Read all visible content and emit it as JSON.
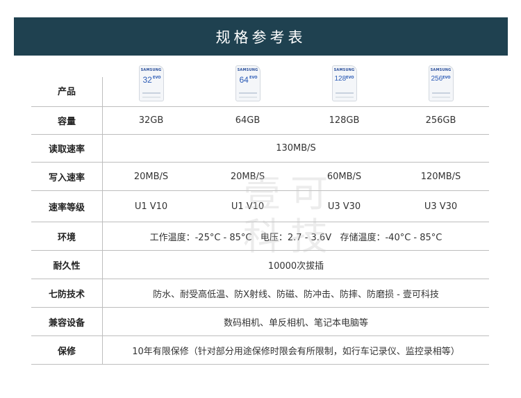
{
  "banner": {
    "title": "规格参考表"
  },
  "watermark": {
    "line1": "壹可",
    "line2": "科技"
  },
  "products": {
    "label": "产品",
    "cards": [
      {
        "brand": "SAMSUNG",
        "capacity": "32",
        "series": "EVO"
      },
      {
        "brand": "SAMSUNG",
        "capacity": "64",
        "series": "EVO"
      },
      {
        "brand": "SAMSUNG",
        "capacity": "128",
        "series": "EVO"
      },
      {
        "brand": "SAMSUNG",
        "capacity": "256",
        "series": "EVO"
      }
    ]
  },
  "rows": {
    "capacity": {
      "label": "容量",
      "values": [
        "32GB",
        "64GB",
        "128GB",
        "256GB"
      ]
    },
    "read": {
      "label": "读取速率",
      "value": "130MB/S"
    },
    "write": {
      "label": "写入速率",
      "values": [
        "20MB/S",
        "20MB/S",
        "60MB/S",
        "120MB/S"
      ]
    },
    "grade": {
      "label": "速率等级",
      "values": [
        "U1 V10",
        "U1 V10",
        "U3 V30",
        "U3 V30"
      ]
    },
    "env": {
      "label": "环境",
      "value": "工作温度：-25°C - 85°C   电压：2.7 - 3.6V   存储温度：-40°C - 85°C"
    },
    "durability": {
      "label": "耐久性",
      "value": "10000次拔插"
    },
    "protection": {
      "label": "七防技术",
      "value": "防水、耐受高低温、防X射线、防磁、防冲击、防摔、防磨损 - 壹可科技"
    },
    "compat": {
      "label": "兼容设备",
      "value": "数码相机、单反相机、笔记本电脑等"
    },
    "warranty": {
      "label": "保修",
      "value": "10年有限保修（针对部分用途保修时限会有所限制，如行车记录仪、监控录相等）"
    }
  }
}
